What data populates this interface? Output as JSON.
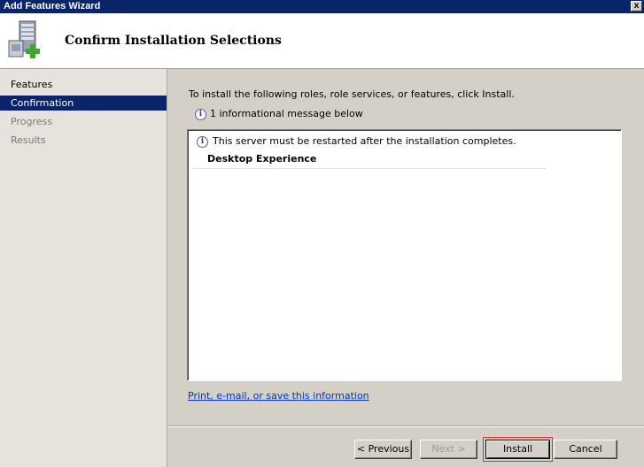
{
  "window": {
    "title": "Add Features Wizard",
    "close_glyph": "x"
  },
  "header": {
    "title": "Confirm Installation Selections",
    "icon": "server-add-icon"
  },
  "sidebar": {
    "items": [
      {
        "label": "Features",
        "state": "done"
      },
      {
        "label": "Confirmation",
        "state": "active"
      },
      {
        "label": "Progress",
        "state": "pending"
      },
      {
        "label": "Results",
        "state": "pending"
      }
    ]
  },
  "main": {
    "instruction": "To install the following roles, role services, or features, click Install.",
    "info_summary": "1 informational message below",
    "list": {
      "message": "This server must be restarted after the installation completes.",
      "feature": "Desktop Experience"
    },
    "link": "Print, e-mail, or save this information"
  },
  "buttons": {
    "previous": "< Previous",
    "next": "Next >",
    "install": "Install",
    "cancel": "Cancel"
  },
  "colors": {
    "titlebar": "#0a246a",
    "active_nav": "#0a246a",
    "focus_outline": "#e0302c",
    "link": "#0033cc"
  }
}
